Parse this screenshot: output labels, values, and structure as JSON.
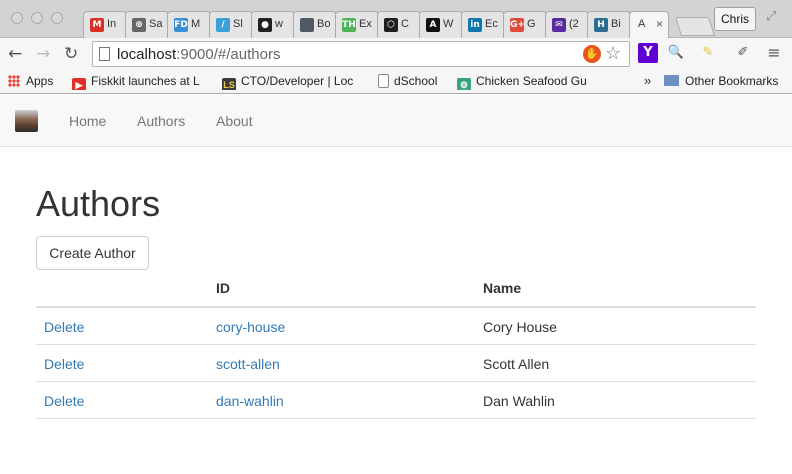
{
  "browser": {
    "tabs": [
      {
        "label": "In",
        "icon": "gmail-icon",
        "color": "#d93025",
        "glyph": "M",
        "active": false
      },
      {
        "label": "Sa",
        "icon": "x-circle-icon",
        "color": "#666666",
        "glyph": "⊗",
        "active": false
      },
      {
        "label": "M",
        "icon": "fd-icon",
        "color": "#3a8fd8",
        "glyph": "FD",
        "active": false
      },
      {
        "label": "Sl",
        "icon": "slash-icon",
        "color": "#3aa0d8",
        "glyph": "/",
        "active": false
      },
      {
        "label": "w",
        "icon": "github-icon",
        "color": "#222222",
        "glyph": "●",
        "active": false
      },
      {
        "label": "Bo",
        "icon": "square-icon",
        "color": "#505a66",
        "glyph": "",
        "active": false
      },
      {
        "label": "Ex",
        "icon": "treehouse-icon",
        "color": "#4fb35b",
        "glyph": "TH",
        "active": false
      },
      {
        "label": "C",
        "icon": "hexagon-icon",
        "color": "#1e1e1e",
        "glyph": "⬡",
        "active": false
      },
      {
        "label": "W",
        "icon": "a-icon",
        "color": "#111111",
        "glyph": "A",
        "active": false
      },
      {
        "label": "Ec",
        "icon": "linkedin-icon",
        "color": "#0e76a8",
        "glyph": "in",
        "active": false
      },
      {
        "label": "G",
        "icon": "google-plus-icon",
        "color": "#dd4b39",
        "glyph": "G+",
        "active": false
      },
      {
        "label": "(2",
        "icon": "mail-icon",
        "color": "#5a2ba0",
        "glyph": "✉",
        "active": false
      },
      {
        "label": "Bi",
        "icon": "h-icon",
        "color": "#2c6e8f",
        "glyph": "H",
        "active": false
      },
      {
        "label": "A",
        "icon": "",
        "color": "#f6f6f6",
        "glyph": "",
        "active": true
      }
    ],
    "profile_name": "Chris",
    "url_host": "localhost",
    "url_rest": ":9000/#/authors",
    "bookmarks": [
      {
        "label": "Apps",
        "icon": "apps-grid-icon",
        "color": "#e84335"
      },
      {
        "label": "Fiskkit launches at L",
        "icon": "youtube-icon",
        "color": "#e52d27"
      },
      {
        "label": "CTO/Developer | Loc",
        "icon": "ls-icon",
        "color": "#3b3b3b"
      },
      {
        "label": "dSchool",
        "icon": "page-icon",
        "color": "#ffffff"
      },
      {
        "label": "Chicken Seafood Gu",
        "icon": "gear-icon",
        "color": "#3aa57a"
      }
    ],
    "overflow_label": "»",
    "other_bookmarks": "Other Bookmarks"
  },
  "app": {
    "nav": [
      "Home",
      "Authors",
      "About"
    ],
    "title": "Authors",
    "create_button": "Create Author",
    "columns": [
      "",
      "ID",
      "Name"
    ],
    "authors": [
      {
        "action": "Delete",
        "id": "cory-house",
        "name": "Cory House"
      },
      {
        "action": "Delete",
        "id": "scott-allen",
        "name": "Scott Allen"
      },
      {
        "action": "Delete",
        "id": "dan-wahlin",
        "name": "Dan Wahlin"
      }
    ]
  }
}
